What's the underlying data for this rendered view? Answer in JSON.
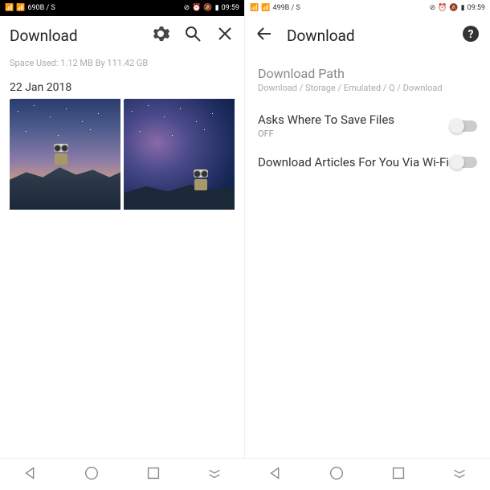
{
  "left": {
    "statusbar": {
      "net": "690B / S",
      "time": "09:59"
    },
    "title": "Download",
    "space_used": "Space Used: 1.12 MB By 111.42 GB",
    "date": "22 Jan 2018"
  },
  "right": {
    "statusbar": {
      "net": "499B / S",
      "time": "09:59"
    },
    "title": "Download",
    "path_title": "Download Path",
    "path": "Download / Storage / Emulated / Q / Download",
    "ask_save": {
      "label": "Asks Where To Save Files",
      "sub": "OFF"
    },
    "wifi": {
      "label": "Download Articles For You Via Wi-Fi"
    }
  }
}
